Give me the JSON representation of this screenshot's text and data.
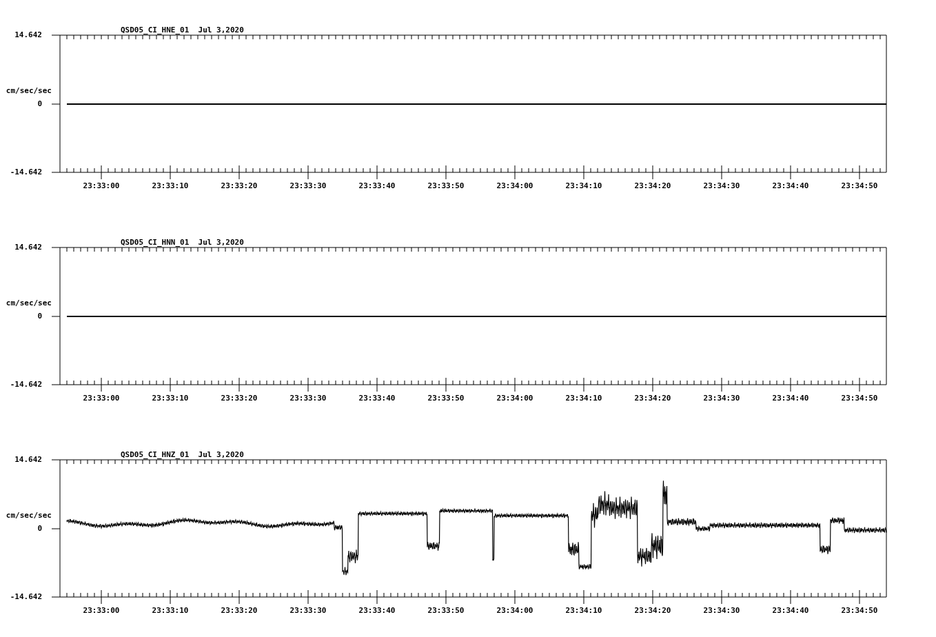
{
  "panels": [
    {
      "title": "QSD05_CI_HNE_01  Jul 3,2020",
      "y_max": "14.642",
      "y_unit": "cm/sec/sec",
      "y_zero": "0",
      "y_min": "-14.642",
      "x_labels": [
        "23:33:00",
        "23:33:10",
        "23:33:20",
        "23:33:30",
        "23:33:40",
        "23:33:50",
        "23:34:00",
        "23:34:10",
        "23:34:20",
        "23:34:30",
        "23:34:40",
        "23:34:50"
      ],
      "kind": "flat"
    },
    {
      "title": "QSD05_CI_HNN_01  Jul 3,2020",
      "y_max": "14.642",
      "y_unit": "cm/sec/sec",
      "y_zero": "0",
      "y_min": "-14.642",
      "x_labels": [
        "23:33:00",
        "23:33:10",
        "23:33:20",
        "23:33:30",
        "23:33:40",
        "23:33:50",
        "23:34:00",
        "23:34:10",
        "23:34:20",
        "23:34:30",
        "23:34:40",
        "23:34:50"
      ],
      "kind": "flat"
    },
    {
      "title": "QSD05_CI_HNZ_01  Jul 3,2020",
      "y_max": "14.642",
      "y_unit": "cm/sec/sec",
      "y_zero": "0",
      "y_min": "-14.642",
      "x_labels": [
        "23:33:00",
        "23:33:10",
        "23:33:20",
        "23:33:30",
        "23:33:40",
        "23:33:50",
        "23:34:00",
        "23:34:10",
        "23:34:20",
        "23:34:30",
        "23:34:40",
        "23:34:50"
      ],
      "kind": "noisy"
    }
  ]
}
